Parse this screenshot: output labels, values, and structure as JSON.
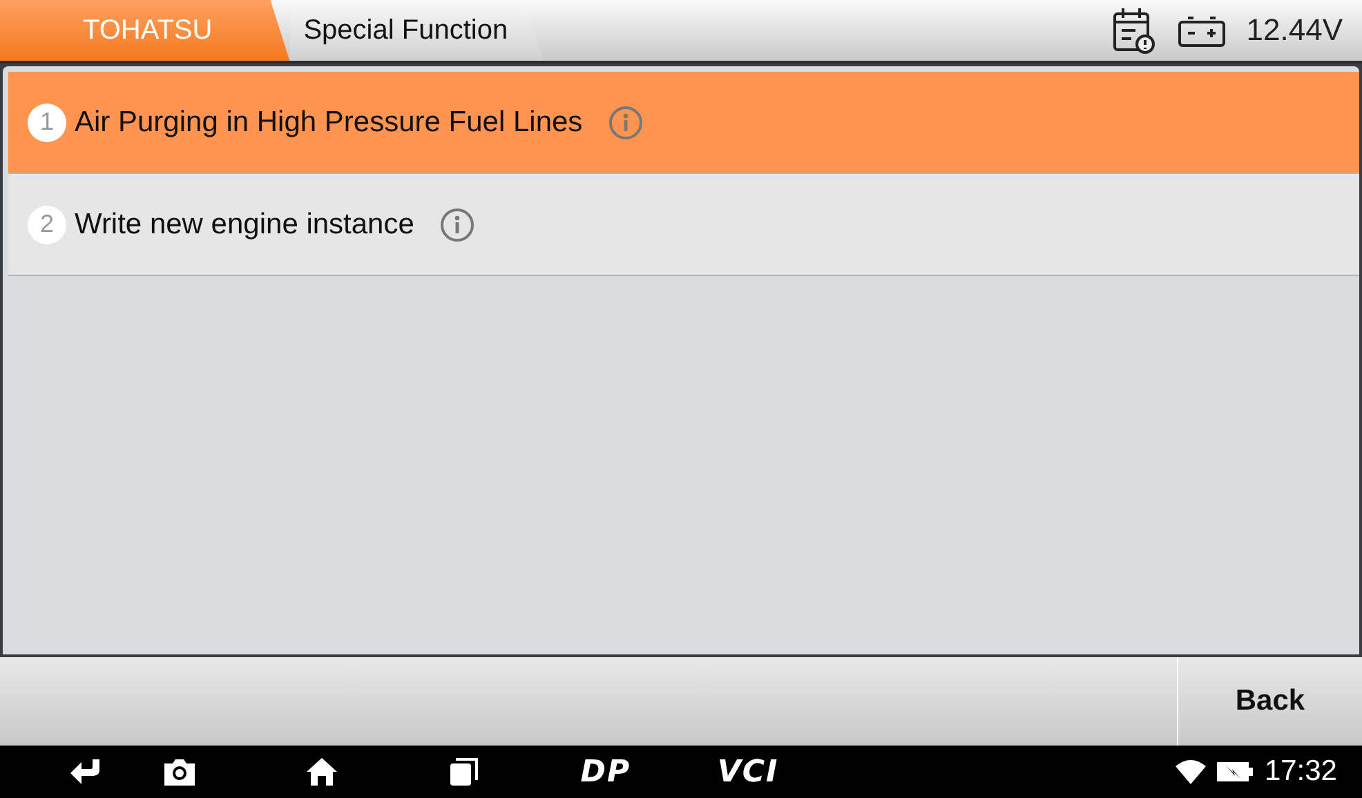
{
  "breadcrumb": [
    {
      "label": "TOHATSU",
      "selected": true
    },
    {
      "label": "Special Function",
      "selected": false
    }
  ],
  "status": {
    "voltage": "12.44V"
  },
  "functions": [
    {
      "number": "1",
      "label": "Air Purging in High Pressure Fuel Lines",
      "selected": true
    },
    {
      "number": "2",
      "label": "Write new engine instance",
      "selected": false
    }
  ],
  "buttons": [
    "Back"
  ],
  "navbar": {
    "dp": "DP",
    "vci": "VCI",
    "time": "17:32"
  }
}
